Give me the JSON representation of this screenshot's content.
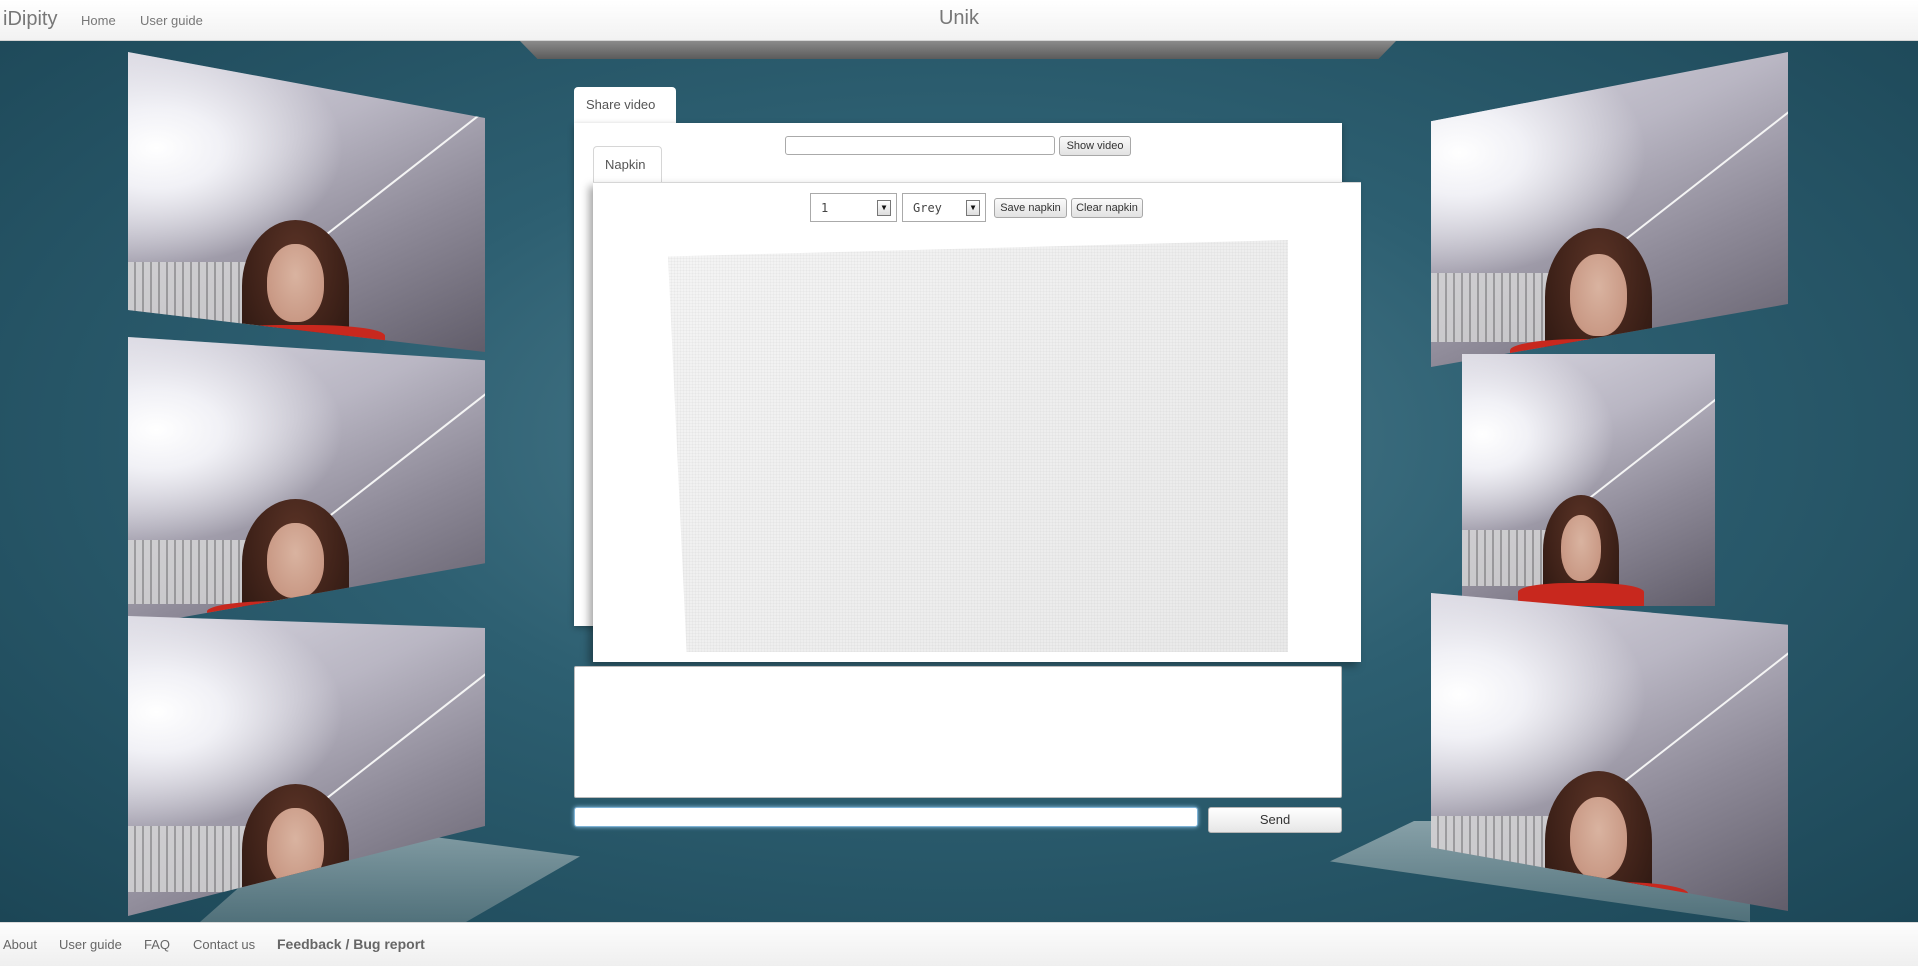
{
  "navbar": {
    "brand": "iDipity",
    "links": [
      {
        "label": "Home"
      },
      {
        "label": "User guide"
      }
    ],
    "room_title": "Unik"
  },
  "share_video": {
    "tab_label": "Share video",
    "url_value": "",
    "show_button": "Show video"
  },
  "napkin": {
    "tab_label": "Napkin",
    "size_value": "1",
    "color_value": "Grey",
    "save_button": "Save napkin",
    "clear_button": "Clear napkin"
  },
  "chat": {
    "log_text": "",
    "input_value": "",
    "send_button": "Send"
  },
  "footer": {
    "links": [
      {
        "label": "About"
      },
      {
        "label": "User guide"
      },
      {
        "label": "FAQ"
      },
      {
        "label": "Contact us"
      }
    ],
    "feedback": "Feedback / Bug report"
  },
  "video_tiles": {
    "left_count": 3,
    "right_count": 3,
    "icon": "webcam-video-feed"
  },
  "colors": {
    "stage_background": "#2d5f71",
    "accent_shirt": "#c8281e",
    "input_focus": "#8ec3e8"
  }
}
